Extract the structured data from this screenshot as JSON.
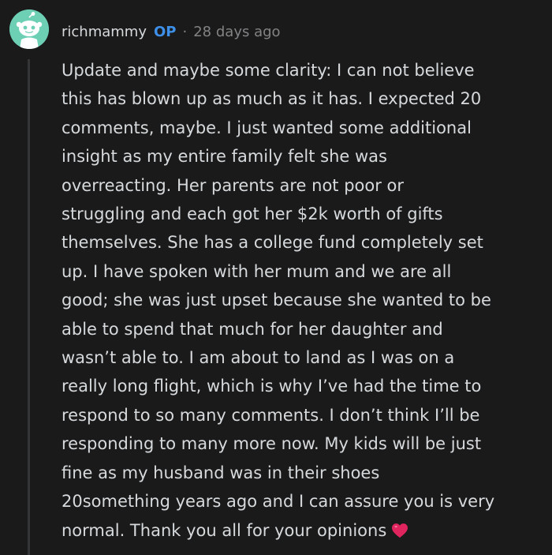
{
  "comment": {
    "author": "richmammy",
    "op_label": "OP",
    "separator": "·",
    "timestamp": "28 days ago",
    "body_lines": [
      "Update and maybe some clarity: I can not believe",
      "this has blown up as much as it has. I expected 20",
      "comments, maybe. I just wanted some additional",
      "insight as my entire family felt she was",
      "overreacting. Her parents are not poor or",
      "struggling and each got her $2k worth of gifts",
      "themselves. She has a college fund completely set",
      "up. I have spoken with her mum and we are all",
      "good; she was just upset because she wanted to be",
      "able to spend that much for her daughter and",
      "wasn’t able to. I am about to land as I was on a",
      "really long flight, which is why I’ve had the time to",
      "respond to so many comments. I don’t think I’ll be",
      "responding to many more now. My kids will be just",
      "fine as my husband was in their shoes",
      "20something years ago and I can assure you is very",
      "normal. Thank you all for your opinions"
    ],
    "trailing_emoji": "heart-icon"
  },
  "colors": {
    "background": "#1a1a1b",
    "text": "#d7dadc",
    "muted": "#818384",
    "op_badge": "#3d8fe8",
    "avatar_bg": "#6dd0b5",
    "thread_line": "#343536",
    "heart": "#e0245e"
  }
}
